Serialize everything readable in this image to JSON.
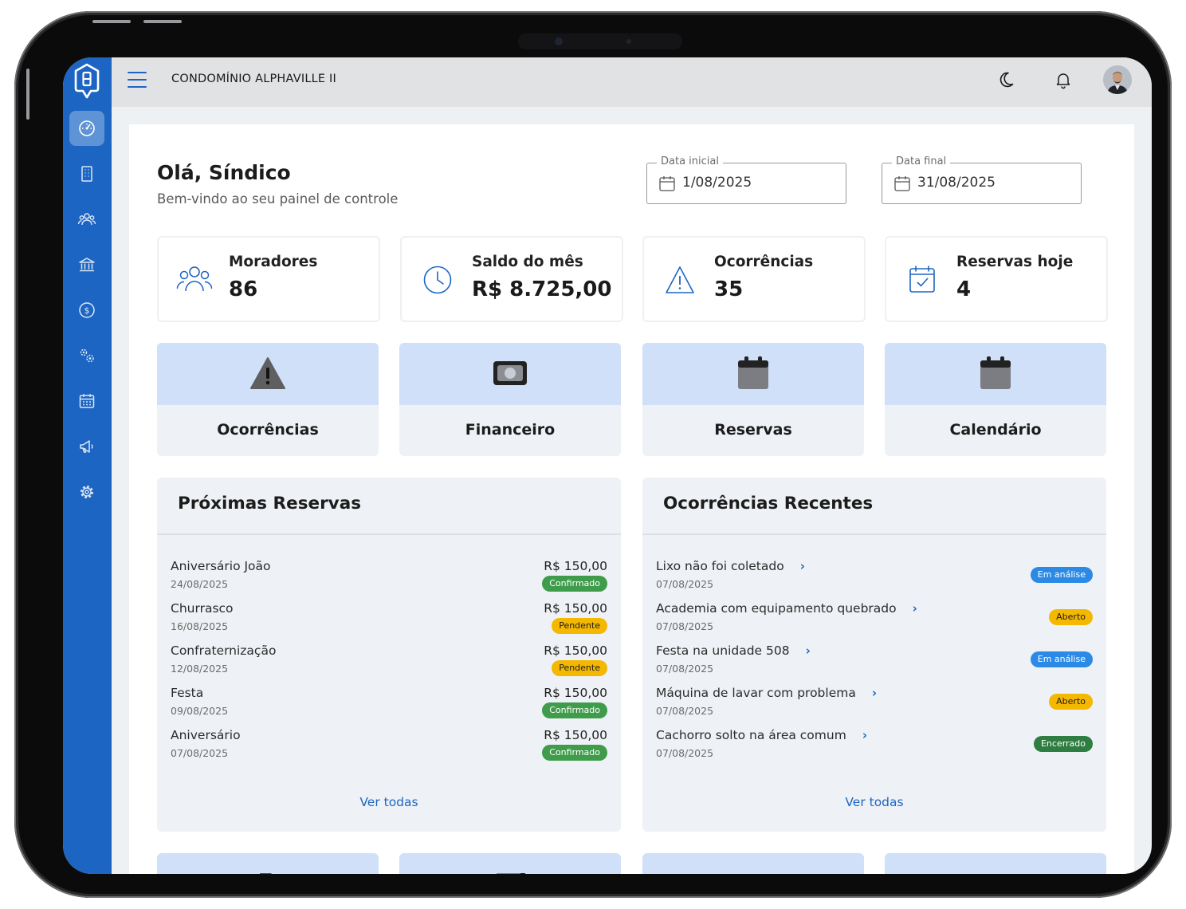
{
  "app": {
    "title": "CONDOMÍNIO ALPHAVILLE II"
  },
  "colors": {
    "brand": "#1d65c2",
    "success": "#3f9c4a",
    "warning": "#f5b800",
    "info": "#2b8ae6",
    "closed": "#2e7d41"
  },
  "sidebar": {
    "items": [
      {
        "icon": "dashboard-icon"
      },
      {
        "icon": "building-icon"
      },
      {
        "icon": "users-icon"
      },
      {
        "icon": "bank-icon"
      },
      {
        "icon": "dollar-icon"
      },
      {
        "icon": "gears-icon"
      },
      {
        "icon": "calendar-grid-icon"
      },
      {
        "icon": "megaphone-icon"
      },
      {
        "icon": "settings-icon"
      }
    ]
  },
  "header": {
    "greeting": "Olá, Síndico",
    "subtitle": "Bem-vindo ao seu painel de controle",
    "date_start": {
      "label": "Data inicial",
      "value": "1/08/2025"
    },
    "date_end": {
      "label": "Data final",
      "value": "31/08/2025"
    }
  },
  "stats": [
    {
      "label": "Moradores",
      "value": "86",
      "icon": "users-icon"
    },
    {
      "label": "Saldo do mês",
      "value": "R$ 8.725,00",
      "icon": "clock-icon"
    },
    {
      "label": "Ocorrências",
      "value": "35",
      "icon": "warning-icon"
    },
    {
      "label": "Reservas hoje",
      "value": "4",
      "icon": "calendar-check-icon"
    }
  ],
  "quick_actions": [
    {
      "label": "Ocorrências",
      "icon": "warning-icon"
    },
    {
      "label": "Financeiro",
      "icon": "money-icon"
    },
    {
      "label": "Reservas",
      "icon": "calendar-icon"
    },
    {
      "label": "Calendário",
      "icon": "calendar-icon"
    }
  ],
  "reservas": {
    "title": "Próximas Reservas",
    "more": "Ver todas",
    "items": [
      {
        "name": "Aniversário João",
        "date": "24/08/2025",
        "amount": "R$ 150,00",
        "status": "Confirmado"
      },
      {
        "name": "Churrasco",
        "date": "16/08/2025",
        "amount": "R$ 150,00",
        "status": "Pendente"
      },
      {
        "name": "Confraternização",
        "date": "12/08/2025",
        "amount": "R$ 150,00",
        "status": "Pendente"
      },
      {
        "name": "Festa",
        "date": "09/08/2025",
        "amount": "R$ 150,00",
        "status": "Confirmado"
      },
      {
        "name": "Aniversário",
        "date": "07/08/2025",
        "amount": "R$ 150,00",
        "status": "Confirmado"
      }
    ]
  },
  "ocorrencias": {
    "title": "Ocorrências Recentes",
    "more": "Ver todas",
    "items": [
      {
        "name": "Lixo não foi coletado",
        "date": "07/08/2025",
        "status": "Em análise"
      },
      {
        "name": "Academia com equipamento quebrado",
        "date": "07/08/2025",
        "status": "Aberto"
      },
      {
        "name": "Festa na unidade 508",
        "date": "07/08/2025",
        "status": "Em análise"
      },
      {
        "name": "Máquina de lavar com problema",
        "date": "07/08/2025",
        "status": "Aberto"
      },
      {
        "name": "Cachorro solto na área comum",
        "date": "07/08/2025",
        "status": "Encerrado"
      }
    ]
  }
}
